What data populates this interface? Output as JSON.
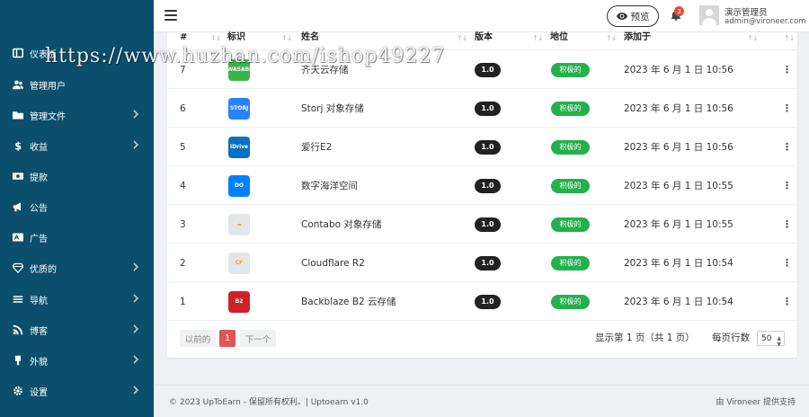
{
  "sidebar": {
    "items": [
      {
        "label": "仪表板",
        "icon": "dashboard-icon",
        "chevron": false
      },
      {
        "label": "管理用户",
        "icon": "users-icon",
        "chevron": false
      },
      {
        "label": "管理文件",
        "icon": "folder-icon",
        "chevron": true
      },
      {
        "label": "收益",
        "icon": "dollar-icon",
        "chevron": true
      },
      {
        "label": "提款",
        "icon": "money-icon",
        "chevron": false
      },
      {
        "label": "公告",
        "icon": "megaphone-icon",
        "chevron": false
      },
      {
        "label": "广告",
        "icon": "ad-icon",
        "chevron": false
      },
      {
        "label": "优质的",
        "icon": "diamond-icon",
        "chevron": true
      },
      {
        "label": "导航",
        "icon": "bars-icon",
        "chevron": true
      },
      {
        "label": "博客",
        "icon": "rss-icon",
        "chevron": true
      },
      {
        "label": "外貌",
        "icon": "brush-icon",
        "chevron": true
      },
      {
        "label": "设置",
        "icon": "gear-icon",
        "chevron": true
      }
    ]
  },
  "topbar": {
    "preview_label": "预览",
    "notification_count": "3",
    "user_name": "演示管理员",
    "user_email": "admin@vironeer.com"
  },
  "table": {
    "headers": {
      "id": "#",
      "logo": "标识",
      "name": "姓名",
      "version": "版本",
      "status": "地位",
      "added": "添加于"
    },
    "rows": [
      {
        "id": "7",
        "name": "齐天云存储",
        "version": "1.0",
        "status": "积极的",
        "added": "2023 年 6 月 1 日 10:56",
        "logo_text": "WASABI",
        "logo_color": "#3cb44b"
      },
      {
        "id": "6",
        "name": "Storj 对象存储",
        "version": "1.0",
        "status": "积极的",
        "added": "2023 年 6 月 1 日 10:56",
        "logo_text": "STORJ",
        "logo_color": "#2683ff"
      },
      {
        "id": "5",
        "name": "爱行E2",
        "version": "1.0",
        "status": "积极的",
        "added": "2023 年 6 月 1 日 10:56",
        "logo_text": "IDrive",
        "logo_color": "#0a6fc2"
      },
      {
        "id": "4",
        "name": "数字海洋空间",
        "version": "1.0",
        "status": "积极的",
        "added": "2023 年 6 月 1 日 10:55",
        "logo_text": "DO",
        "logo_color": "#0080ff"
      },
      {
        "id": "3",
        "name": "Contabo 对象存储",
        "version": "1.0",
        "status": "积极的",
        "added": "2023 年 6 月 1 日 10:55",
        "logo_text": "☁",
        "logo_color": "#e4e7ea"
      },
      {
        "id": "2",
        "name": "Cloudflare R2",
        "version": "1.0",
        "status": "积极的",
        "added": "2023 年 6 月 1 日 10:54",
        "logo_text": "CF",
        "logo_color": "#e4e7ea"
      },
      {
        "id": "1",
        "name": "Backblaze B2 云存储",
        "version": "1.0",
        "status": "积极的",
        "added": "2023 年 6 月 1 日 10:54",
        "logo_text": "B2",
        "logo_color": "#d0212a"
      }
    ]
  },
  "pagination": {
    "prev_label": "以前的",
    "current_page": "1",
    "next_label": "下一个",
    "info": "显示第 1 页（共 1 页）",
    "rows_label": "每页行数",
    "rows_value": "50"
  },
  "footer": {
    "left": "© 2023 UpToEarn - 保留所有权利。| Uptoearn v1.0",
    "right": "由 Vironeer 提供支持"
  },
  "watermark": "https://www.huzhan.com/ishop49227",
  "colors": {
    "sidebar_bg": "#0b4f6c",
    "active_status": "#22b14c",
    "version_pill": "#222222",
    "current_page": "#e55353"
  }
}
